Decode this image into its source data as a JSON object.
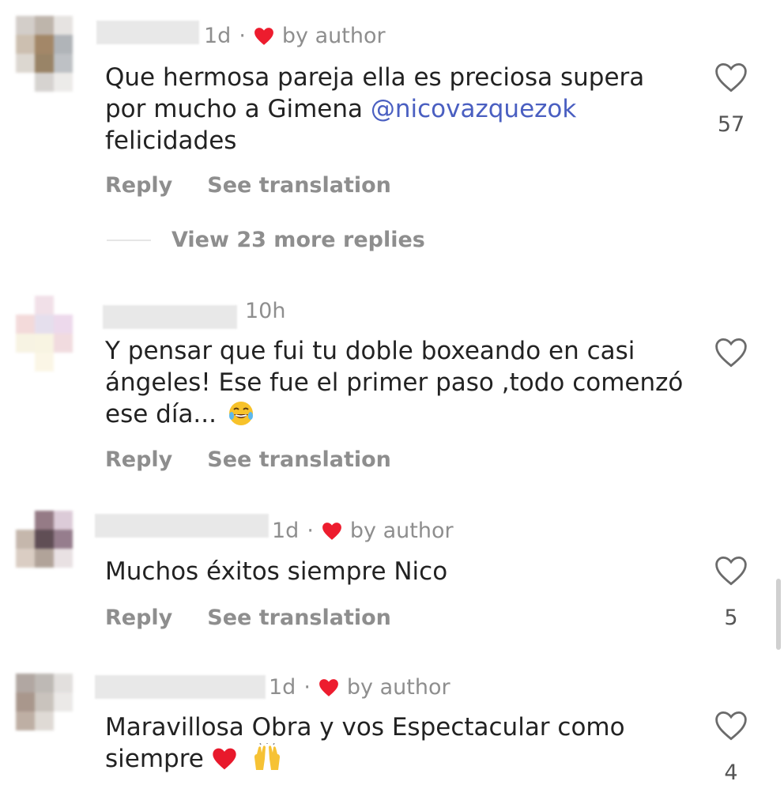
{
  "colors": {
    "accent_heart": "#ed1c2e",
    "mention": "#4a5fc1",
    "muted": "#8e8e8e",
    "text": "#222222"
  },
  "comments": [
    {
      "time": "1d",
      "author_badge": "by author",
      "text_before": "Que hermosa pareja ella es preciosa supera por mucho a Gimena ",
      "mention": "@nicovazquezok",
      "text_after": " felicidades",
      "reply_label": "Reply",
      "translate_label": "See translation",
      "likes": "57",
      "view_replies": "View 23 more replies"
    },
    {
      "time": "10h",
      "text": "Y pensar que fui tu doble boxeando en casi ángeles! Ese fue el primer paso ,todo comenzó ese día...",
      "emoji": "laughing-crying-emoji",
      "reply_label": "Reply",
      "translate_label": "See translation"
    },
    {
      "time": "1d",
      "author_badge": "by author",
      "text": "Muchos éxitos siempre Nico",
      "reply_label": "Reply",
      "translate_label": "See translation",
      "likes": "5"
    },
    {
      "time": "1d",
      "author_badge": "by author",
      "text": "Maravillosa Obra y vos Espectacular como siempre",
      "emojis": [
        "red-heart-emoji",
        "raised-hands-emoji"
      ],
      "likes": "4"
    }
  ]
}
